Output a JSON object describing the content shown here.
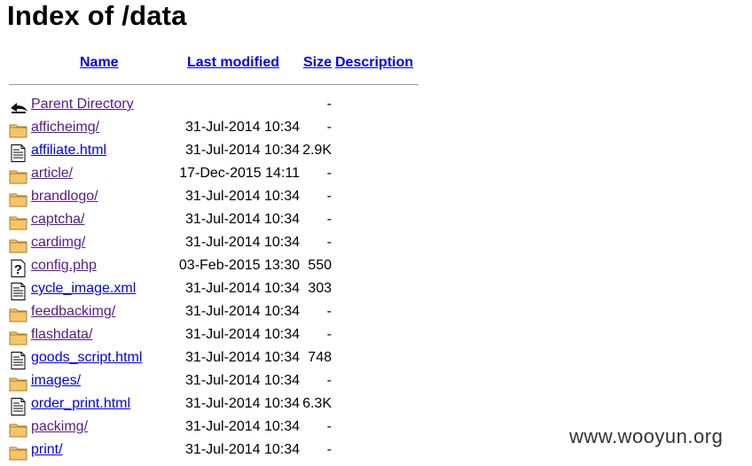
{
  "page": {
    "title": "Index of /data"
  },
  "columns": {
    "name": "Name",
    "last_modified": "Last modified",
    "size": "Size",
    "description": "Description"
  },
  "entries": [
    {
      "name": "Parent Directory",
      "modified": "",
      "size": "-",
      "icon": "back-icon",
      "visited": true
    },
    {
      "name": "afficheimg/",
      "modified": "31-Jul-2014 10:34",
      "size": "-",
      "icon": "folder-icon",
      "visited": true
    },
    {
      "name": "affiliate.html",
      "modified": "31-Jul-2014 10:34",
      "size": "2.9K",
      "icon": "text-file-icon",
      "visited": false
    },
    {
      "name": "article/",
      "modified": "17-Dec-2015 14:11",
      "size": "-",
      "icon": "folder-icon",
      "visited": true
    },
    {
      "name": "brandlogo/",
      "modified": "31-Jul-2014 10:34",
      "size": "-",
      "icon": "folder-icon",
      "visited": true
    },
    {
      "name": "captcha/",
      "modified": "31-Jul-2014 10:34",
      "size": "-",
      "icon": "folder-icon",
      "visited": true
    },
    {
      "name": "cardimg/",
      "modified": "31-Jul-2014 10:34",
      "size": "-",
      "icon": "folder-icon",
      "visited": true
    },
    {
      "name": "config.php",
      "modified": "03-Feb-2015 13:30",
      "size": "550",
      "icon": "unknown-file-icon",
      "visited": true
    },
    {
      "name": "cycle_image.xml",
      "modified": "31-Jul-2014 10:34",
      "size": "303",
      "icon": "text-file-icon",
      "visited": false
    },
    {
      "name": "feedbackimg/",
      "modified": "31-Jul-2014 10:34",
      "size": "-",
      "icon": "folder-icon",
      "visited": true
    },
    {
      "name": "flashdata/",
      "modified": "31-Jul-2014 10:34",
      "size": "-",
      "icon": "folder-icon",
      "visited": true
    },
    {
      "name": "goods_script.html",
      "modified": "31-Jul-2014 10:34",
      "size": "748",
      "icon": "text-file-icon",
      "visited": false
    },
    {
      "name": "images/",
      "modified": "31-Jul-2014 10:34",
      "size": "-",
      "icon": "folder-icon",
      "visited": false
    },
    {
      "name": "order_print.html",
      "modified": "31-Jul-2014 10:34",
      "size": "6.3K",
      "icon": "text-file-icon",
      "visited": false
    },
    {
      "name": "packimg/",
      "modified": "31-Jul-2014 10:34",
      "size": "-",
      "icon": "folder-icon",
      "visited": true
    },
    {
      "name": "print/",
      "modified": "31-Jul-2014 10:34",
      "size": "-",
      "icon": "folder-icon",
      "visited": false
    }
  ],
  "watermark": "www.wooyun.org",
  "colors": {
    "link": "#0000ee",
    "visited": "#551a8b",
    "folder_fill": "#f5c56b",
    "folder_stroke": "#b07d1e",
    "rule": "#9a9a9a"
  }
}
